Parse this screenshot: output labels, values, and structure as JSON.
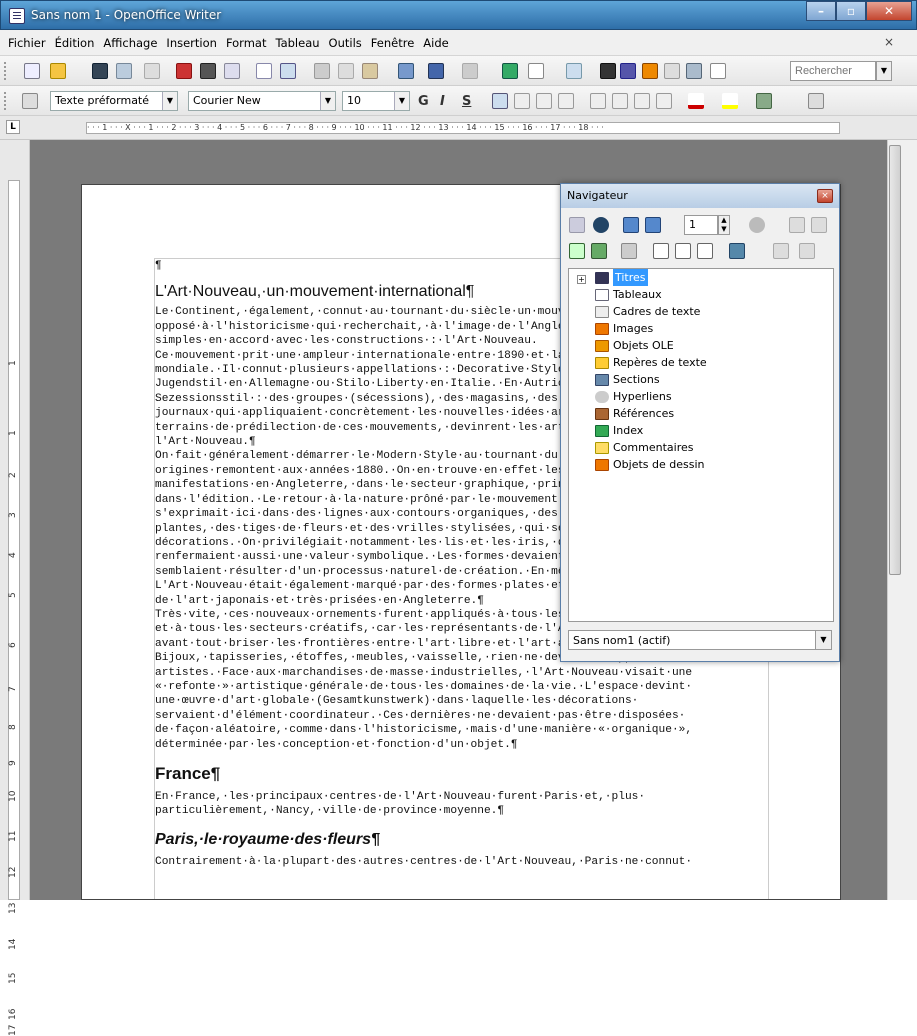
{
  "window": {
    "title": "Sans nom 1 - OpenOffice Writer"
  },
  "menu": [
    "Fichier",
    "Édition",
    "Affichage",
    "Insertion",
    "Format",
    "Tableau",
    "Outils",
    "Fenêtre",
    "Aide"
  ],
  "menu_close": "×",
  "formatting": {
    "style": "Texte préformaté",
    "font": "Courier New",
    "size": "10",
    "bold": "G",
    "italic": "I",
    "underline": "S"
  },
  "search": {
    "placeholder": "Rechercher"
  },
  "ruler": {
    "labels": "· · · 1 · · · X · · · 1 · · · 2 · · · 3 · · · 4 · · · 5 · · · 6 · · · 7 · · · 8 · · · 9 · · · 10 · · · 11 · · · 12 · · · 13 · · · 14 · · · 15 · · · 16 · · · 17 · · · 18 · · ·",
    "tab": "L"
  },
  "vruler": [
    "1",
    "1",
    "2",
    "3",
    "4",
    "5",
    "6",
    "7",
    "8",
    "9",
    "10",
    "11",
    "12",
    "13",
    "14",
    "15",
    "16",
    "17"
  ],
  "document": {
    "pilcrow": "¶",
    "heading1": "L'Art·Nouveau,·un·mouvement·international¶",
    "para1": "Le·Continent,·également,·connut·au·tournant·du·siècle·un·mouvement·artistique\nopposé·à·l'historicisme·qui·recherchait,·à·l'image·de·l'Angleterre,·des·formes\nsimples·en·accord·avec·les·constructions·:·l'Art·Nouveau.\nCe·mouvement·prit·une·ampleur·internationale·entre·1890·et·la·Première·Guerre\nmondiale.·Il·connut·plusieurs·appellations·:·Decorative·Style·en·Angleterre,\nJugendstil·en·Allemagne·ou·Stilo·Liberty·en·Italie.·En·Autriche,·on·parlait·de\nSezessionsstil·:·des·groupes·(sécessions),·des·magasins,·des·ateliers·et·des\njournaux·qui·appliquaient·concrètement·les·nouvelles·idées·artistiques.·Les\nterrains·de·prédilection·de·ces·mouvements,·devinrent·les·arts·décoratifs·de\nl'Art·Nouveau.¶",
    "para2": "On·fait·généralement·démarrer·le·Modern·Style·au·tournant·du·siècle·mais·ses\norigines·remontent·aux·années·1880.·On·en·trouve·en·effet·les·premières\nmanifestations·en·Angleterre,·dans·le·secteur·graphique,·principalement\ndans·l'édition.·Le·retour·à·la·nature·prôné·par·le·mouvement·Arts·and·Crafts\ns'exprimait·ici·dans·des·lignes·aux·contours·organiques,·des·feuilles,·des\nplantes,·des·tiges·de·fleurs·et·des·vrilles·stylisées,·qui·servaient·de\ndécorations.·On·privilégiait·notamment·les·lis·et·les·iris,·qui\nrenfermaient·aussi·une·valeur·symbolique.·Les·formes·devaient·être·libres·et\nsemblaient·résulter·d'un·processus·naturel·de·création.·En·même·temps,\nL'Art·Nouveau·était·également·marqué·par·des·formes·plates·et·linéaires·issues\nde·l'art·japonais·et·très·prisées·en·Angleterre.¶",
    "para3": "Très·vite,·ces·nouveaux·ornements·furent·appliqués·à·tous·les·objets·du·quotidien\net·à·tous·les·secteurs·créatifs,·car·les·représentants·de·l'Art·Nouveau·voulaient\navant·tout·briser·les·frontières·entre·l'art·libre·et·l'art·appliqué.\nBijoux,·tapisseries,·étoffes,·meubles,·vaisselle,·rien·ne·devait·échapper·aux·\nartistes.·Face·aux·marchandises·de·masse·industrielles,·l'Art·Nouveau·visait·une\n«·refonte·»·artistique·générale·de·tous·les·domaines·de·la·vie.·L'espace·devint·\nune·œuvre·d'art·globale·(Gesamtkunstwerk)·dans·laquelle·les·décorations·\nservaient·d'élément·coordinateur.·Ces·dernières·ne·devaient·pas·être·disposées·\nde·façon·aléatoire,·comme·dans·l'historicisme,·mais·d'une·manière·«·organique·»,\ndéterminée·par·les·conception·et·fonction·d'un·objet.¶",
    "heading2": "France¶",
    "para4": "En·France,·les·principaux·centres·de·l'Art·Nouveau·furent·Paris·et,·plus·\nparticulièrement,·Nancy,·ville·de·province·moyenne.¶",
    "heading3": "Paris,·le·royaume·des·fleurs¶",
    "para5": "Contrairement·à·la·plupart·des·autres·centres·de·l'Art·Nouveau,·Paris·ne·connut·"
  },
  "navigator": {
    "title": "Navigateur",
    "close": "×",
    "spin_value": "1",
    "items": [
      "Titres",
      "Tableaux",
      "Cadres de texte",
      "Images",
      "Objets OLE",
      "Repères de texte",
      "Sections",
      "Hyperliens",
      "Références",
      "Index",
      "Commentaires",
      "Objets de dessin"
    ],
    "combo": "Sans nom1 (actif)",
    "expand": "+"
  },
  "colors": {
    "accent": "#3399ff",
    "titlebar": "#2e6ea8"
  }
}
